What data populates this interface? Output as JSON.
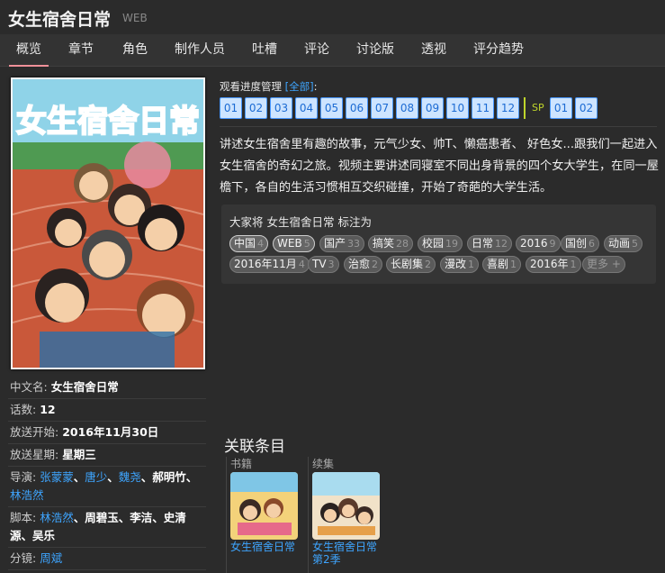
{
  "header": {
    "title": "女生宿舍日常",
    "subtype": "WEB"
  },
  "nav": [
    "概览",
    "章节",
    "角色",
    "制作人员",
    "吐槽",
    "评论",
    "讨论版",
    "透视",
    "评分趋势"
  ],
  "progress": {
    "label": "观看进度管理",
    "all_link": "[全部]",
    "colon": ":",
    "episodes": [
      "01",
      "02",
      "03",
      "04",
      "05",
      "06",
      "07",
      "08",
      "09",
      "10",
      "11",
      "12"
    ],
    "sp_label": "SP",
    "sp_episodes": [
      "01",
      "02"
    ]
  },
  "summary": "讲述女生宿舍里有趣的故事，元气少女、帅T、懒癌患者、 好色女...跟我们一起进入女生宿舍的奇幻之旅。视频主要讲述同寝室不同出身背景的四个女大学生，在同一屋檐下，各自的生活习惯相互交织碰撞，开始了奇葩的大学生活。",
  "tags": {
    "title": "大家将 女生宿舍日常 标注为",
    "items": [
      {
        "name": "中国",
        "count": "4"
      },
      {
        "name": "WEB",
        "count": "5"
      },
      {
        "name": "国产",
        "count": "33"
      },
      {
        "name": "搞笑",
        "count": "28"
      },
      {
        "name": "校园",
        "count": "19"
      },
      {
        "name": "日常",
        "count": "12"
      },
      {
        "name": "2016",
        "count": "9"
      },
      {
        "name": "国创",
        "count": "6"
      },
      {
        "name": "动画",
        "count": "5"
      },
      {
        "name": "2016年11月",
        "count": "4"
      },
      {
        "name": "TV",
        "count": "3"
      },
      {
        "name": "治愈",
        "count": "2"
      },
      {
        "name": "长剧集",
        "count": "2"
      },
      {
        "name": "漫改",
        "count": "1"
      },
      {
        "name": "喜剧",
        "count": "1"
      },
      {
        "name": "2016年",
        "count": "1"
      }
    ],
    "more": "更多 +"
  },
  "infobox": {
    "cn_name_key": "中文名: ",
    "cn_name": "女生宿舍日常",
    "episodes_key": "话数: ",
    "episodes": "12",
    "start_key": "放送开始: ",
    "start": "2016年11月30日",
    "weekday_key": "放送星期: ",
    "weekday": "星期三",
    "director_key": "导演: ",
    "director_links": [
      "张蒙蒙",
      "唐少",
      "魏尧"
    ],
    "director_plain": "郝明竹",
    "director_last": "林浩然",
    "script_key": "脚本: ",
    "script_link": "林浩然",
    "script_plain": "周碧玉、李洁、史清源、吴乐",
    "storyboard_key": "分镜: ",
    "storyboard_link": "周斌",
    "sep": "、"
  },
  "poster": {
    "logo_text": "女生宿舍日常"
  },
  "related": {
    "title": "关联条目",
    "items": [
      {
        "category": "书籍",
        "name": "女生宿舍日常"
      },
      {
        "category": "续集",
        "name": "女生宿舍日常第2季"
      }
    ]
  },
  "colors": {
    "link": "#3ea5ff",
    "accent": "#f09199",
    "episode_bg": "#cde4ff",
    "sp": "#bfd52b"
  }
}
